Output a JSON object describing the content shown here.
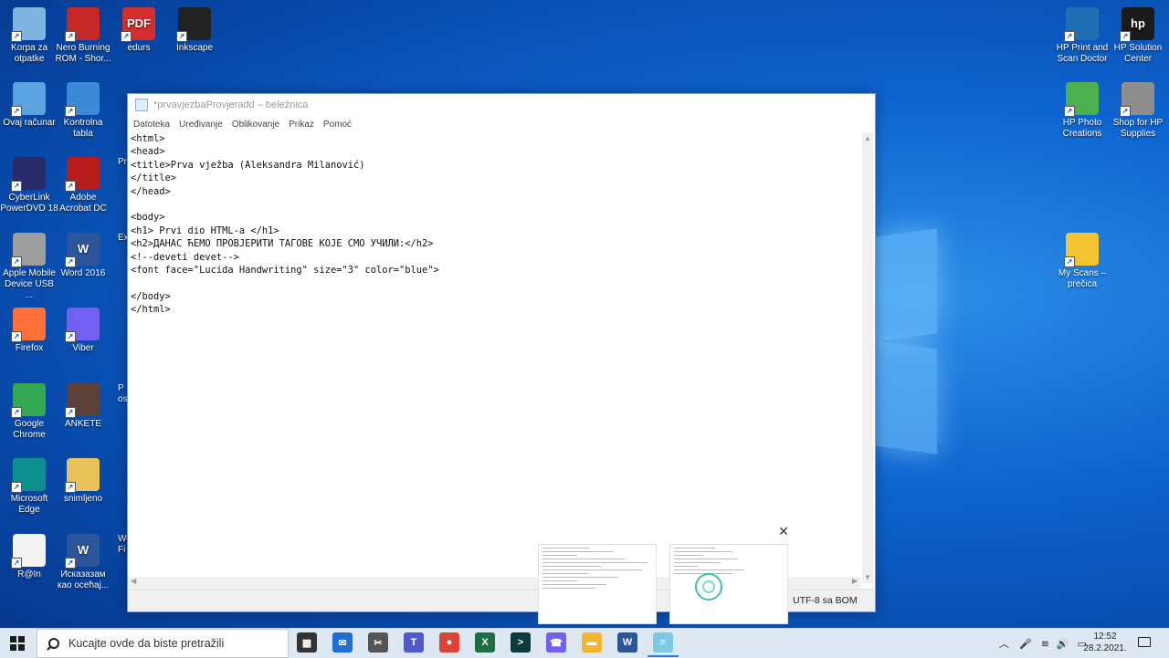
{
  "desktop": {
    "icons_left": [
      {
        "label": "Korpa za otpatke",
        "icon": "recycle-bin-icon",
        "color": "#7fb3e0"
      },
      {
        "label": "Nero Burning ROM - Shor...",
        "icon": "nero-icon",
        "color": "#c62828"
      },
      {
        "label": "edurs",
        "icon": "pdf-icon",
        "color": "#d32f2f",
        "glyph": "PDF"
      },
      {
        "label": "Inkscape",
        "icon": "inkscape-icon",
        "color": "#222222"
      },
      {
        "label": "Ovaj računar",
        "icon": "computer-icon",
        "color": "#5ba3e0"
      },
      {
        "label": "Kontrolna tabla",
        "icon": "control-panel-icon",
        "color": "#3a8ad8"
      },
      {
        "label": "CyberLink PowerDVD 18",
        "icon": "powerdvd-icon",
        "color": "#2a2a6a"
      },
      {
        "label": "Adobe Acrobat DC",
        "icon": "acrobat-icon",
        "color": "#b71c1c"
      },
      {
        "label": "Apple Mobile Device USB ...",
        "icon": "device-icon",
        "color": "#9e9e9e"
      },
      {
        "label": "Word 2016",
        "icon": "word-icon",
        "color": "#2b579a",
        "glyph": "W"
      },
      {
        "label": "Firefox",
        "icon": "firefox-icon",
        "color": "#ff7139"
      },
      {
        "label": "Viber",
        "icon": "viber-icon",
        "color": "#7360f2"
      },
      {
        "label": "Google Chrome",
        "icon": "chrome-icon",
        "color": "#34a853"
      },
      {
        "label": "ANKETE",
        "icon": "image-file-icon",
        "color": "#5d4037"
      },
      {
        "label": "Microsoft Edge",
        "icon": "edge-icon",
        "color": "#0c8f8f"
      },
      {
        "label": "snimljeno",
        "icon": "zip-folder-icon",
        "color": "#e8c35a"
      },
      {
        "label": "R@In",
        "icon": "text-file-icon",
        "color": "#f2f2f2"
      },
      {
        "label": "Исказазам као осећај...",
        "icon": "word-doc-icon",
        "color": "#2b579a",
        "glyph": "W"
      }
    ],
    "icons_partial": [
      {
        "label": "Ex",
        "icon": "excel-partial-icon",
        "color": "#1d6f42"
      },
      {
        "label": "Pro",
        "icon": "acrobat-partial-icon",
        "color": "#b71c1c"
      },
      {
        "label": "P",
        "icon": "word-partial-icon",
        "color": "#2b579a"
      },
      {
        "label": "osn",
        "icon": "doc-partial-icon",
        "color": "#333333"
      },
      {
        "label": "Wo",
        "icon": "word-partial-icon-2",
        "color": "#333333"
      },
      {
        "label": "Fi",
        "icon": "file-partial-icon",
        "color": "#333333"
      }
    ],
    "icons_right": [
      {
        "label": "HP Print and Scan Doctor",
        "icon": "hp-scan-doctor-icon",
        "color": "#1f6fb5"
      },
      {
        "label": "HP Solution Center",
        "icon": "hp-logo-icon",
        "color": "#1a1a1a",
        "glyph": "hp"
      },
      {
        "label": "HP Photo Creations",
        "icon": "hp-photo-icon",
        "color": "#4caf50"
      },
      {
        "label": "Shop for HP Supplies",
        "icon": "hp-printer-icon",
        "color": "#8e8e8e"
      },
      {
        "label": "My Scans – prečica",
        "icon": "folder-icon",
        "color": "#f4c430"
      }
    ]
  },
  "notepad": {
    "title": "*prvavjezbaProvjeradd – beležnica",
    "menu": [
      "Datoteka",
      "Uređivanje",
      "Oblikovanje",
      "Prikaz",
      "Pomoć"
    ],
    "content_lines": [
      "<html>",
      "<head>",
      "<title>Prva vježba (Aleksandra Milanović)",
      "</title>",
      "</head>",
      "",
      "<body>",
      "<h1> Prvi dio HTML-a </h1>",
      "<h2>ДАНАС ЋЕМО ПРОВЈЕРИТИ ТАГОВЕ КОЈЕ СМО УЧИЛИ:</h2>",
      "<!--deveti devet-->",
      "<font face=\"Lucida Handwriting\" size=\"3\" color=\"blue\">",
      "",
      "</body>",
      "</html>"
    ],
    "status_encoding": "UTF-8 sa BOM"
  },
  "taskbar": {
    "search_placeholder": "Kucajte ovde da biste pretražili",
    "apps": [
      {
        "name": "store",
        "icon": "store-icon",
        "color": "#333333"
      },
      {
        "name": "mail",
        "icon": "mail-icon",
        "color": "#1e6fd0"
      },
      {
        "name": "snip",
        "icon": "snip-icon",
        "color": "#555555"
      },
      {
        "name": "teams",
        "icon": "teams-icon",
        "color": "#5059c9"
      },
      {
        "name": "chrome",
        "icon": "chrome-icon",
        "color": "#db4437"
      },
      {
        "name": "excel",
        "icon": "excel-icon",
        "color": "#1d6f42"
      },
      {
        "name": "terminal",
        "icon": "terminal-icon",
        "color": "#0b3b3b"
      },
      {
        "name": "viber",
        "icon": "viber-icon",
        "color": "#7360f2"
      },
      {
        "name": "explorer",
        "icon": "file-explorer-icon",
        "color": "#f2b632"
      },
      {
        "name": "word",
        "icon": "word-icon",
        "color": "#2b579a"
      },
      {
        "name": "notepad",
        "icon": "notepad-icon",
        "color": "#7ec8e3"
      }
    ],
    "time": "12:52",
    "date": "28.2.2021."
  }
}
